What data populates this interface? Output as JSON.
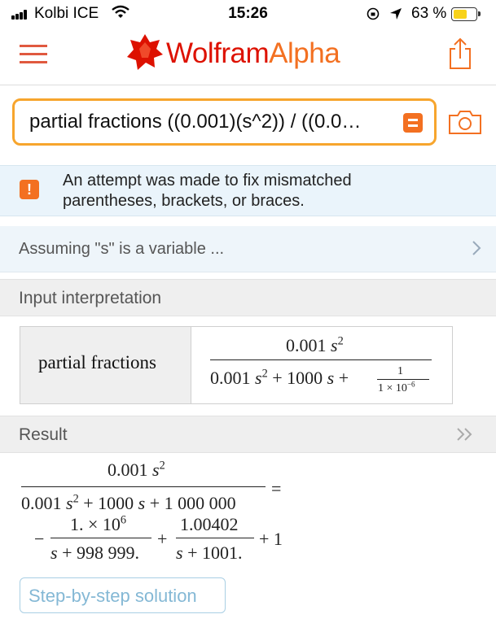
{
  "status_bar": {
    "carrier": "Kolbi ICE",
    "time": "15:26",
    "battery_percent": "63 %",
    "battery_level": 0.63
  },
  "header": {
    "brand_main": "Wolfram",
    "brand_accent": "Alpha",
    "brand_color": "#dd1100",
    "accent_color": "#f37021"
  },
  "search": {
    "value": "partial fractions ((0.001)(s^2)) / ((0.0…"
  },
  "notice": {
    "line1": "An attempt was made to fix mismatched",
    "line2": "parentheses, brackets, or braces."
  },
  "assumption": {
    "text": "Assuming \"s\" is a variable ..."
  },
  "input_interpretation": {
    "title": "Input interpretation",
    "label": "partial fractions",
    "num": "0.001",
    "den_a": "0.001",
    "den_b": "+ 1000",
    "den_c": "+",
    "small_num": "1",
    "small_den": "1 × 10",
    "small_exp": "−6"
  },
  "result": {
    "title": "Result",
    "num": "0.001",
    "den_a": "0.001",
    "den_b": "+ 1000",
    "den_c": "+ 1 000 000",
    "equals": "=",
    "minus": "−",
    "t1_num": "1. × 10",
    "t1_exp": "6",
    "t1_den": "+ 998 999.",
    "plus1": "+",
    "t2_num": "1.00402",
    "t2_den": "+ 1001.",
    "tail": "+ 1"
  },
  "step_button": {
    "label": "Step-by-step solution"
  }
}
